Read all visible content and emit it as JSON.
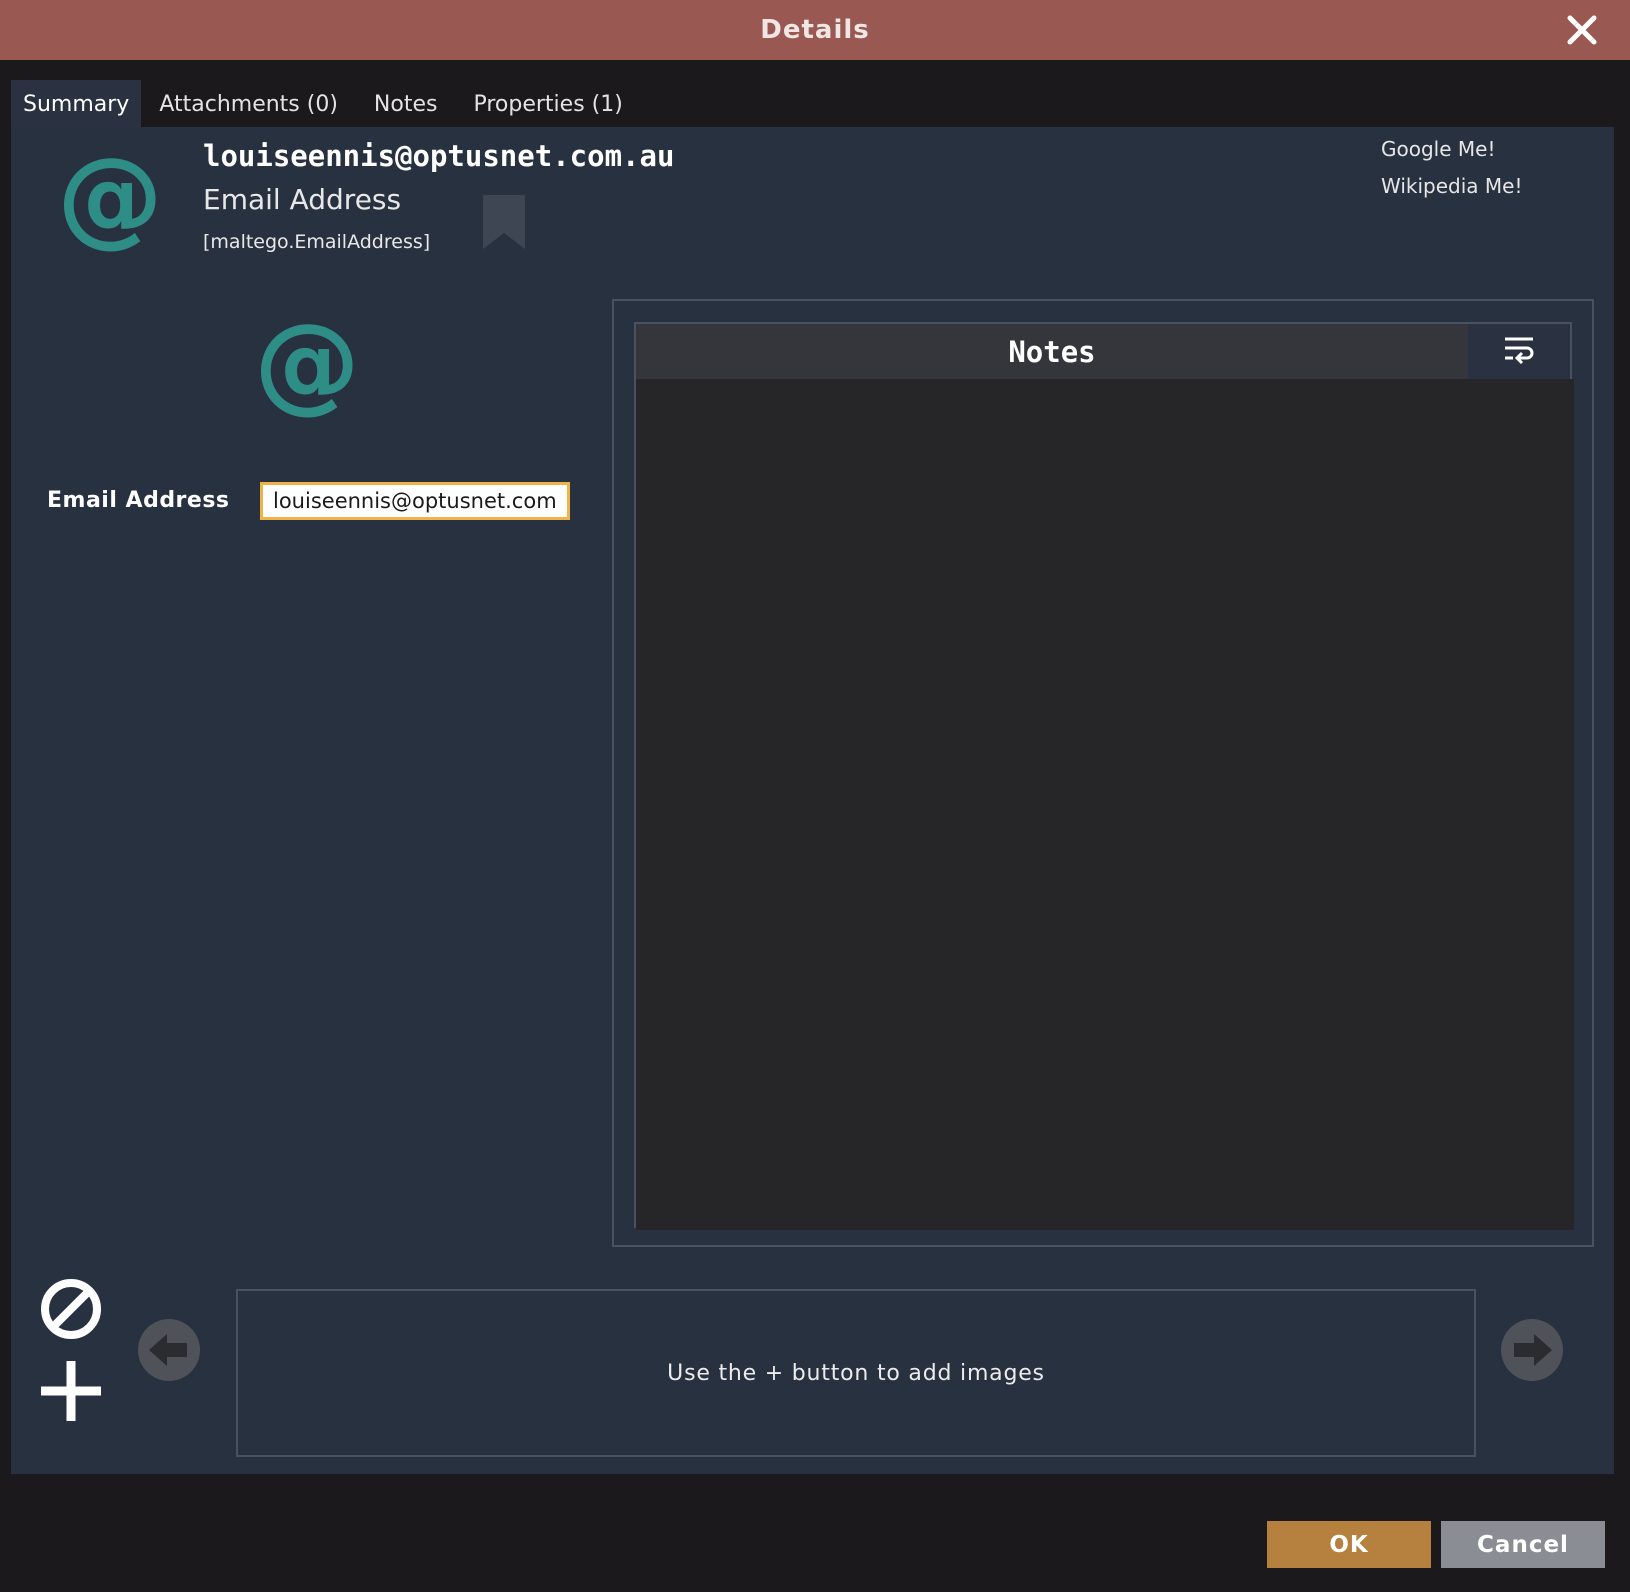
{
  "window": {
    "title": "Details"
  },
  "tabs": [
    {
      "label": "Summary",
      "active": true
    },
    {
      "label": "Attachments (0)",
      "active": false
    },
    {
      "label": "Notes",
      "active": false
    },
    {
      "label": "Properties (1)",
      "active": false
    }
  ],
  "entity": {
    "icon_glyph": "@",
    "value": "louiseennis@optusnet.com.au",
    "type_label": "Email Address",
    "type_id": "[maltego.EmailAddress]",
    "bookmark_icon": "bookmark-icon"
  },
  "links": {
    "google": "Google Me!",
    "wikipedia": "Wikipedia Me!"
  },
  "properties": [
    {
      "label": "Email Address",
      "value": "louiseennis@optusnet.com.au"
    }
  ],
  "notes": {
    "title": "Notes",
    "content": ""
  },
  "images": {
    "placeholder": "Use the + button to add images"
  },
  "buttons": {
    "ok": "OK",
    "cancel": "Cancel"
  },
  "colors": {
    "title_bar": "#995952",
    "accent_icon": "#2f8d88",
    "ok_button": "#b6813e",
    "input_focus": "#f0b446"
  }
}
